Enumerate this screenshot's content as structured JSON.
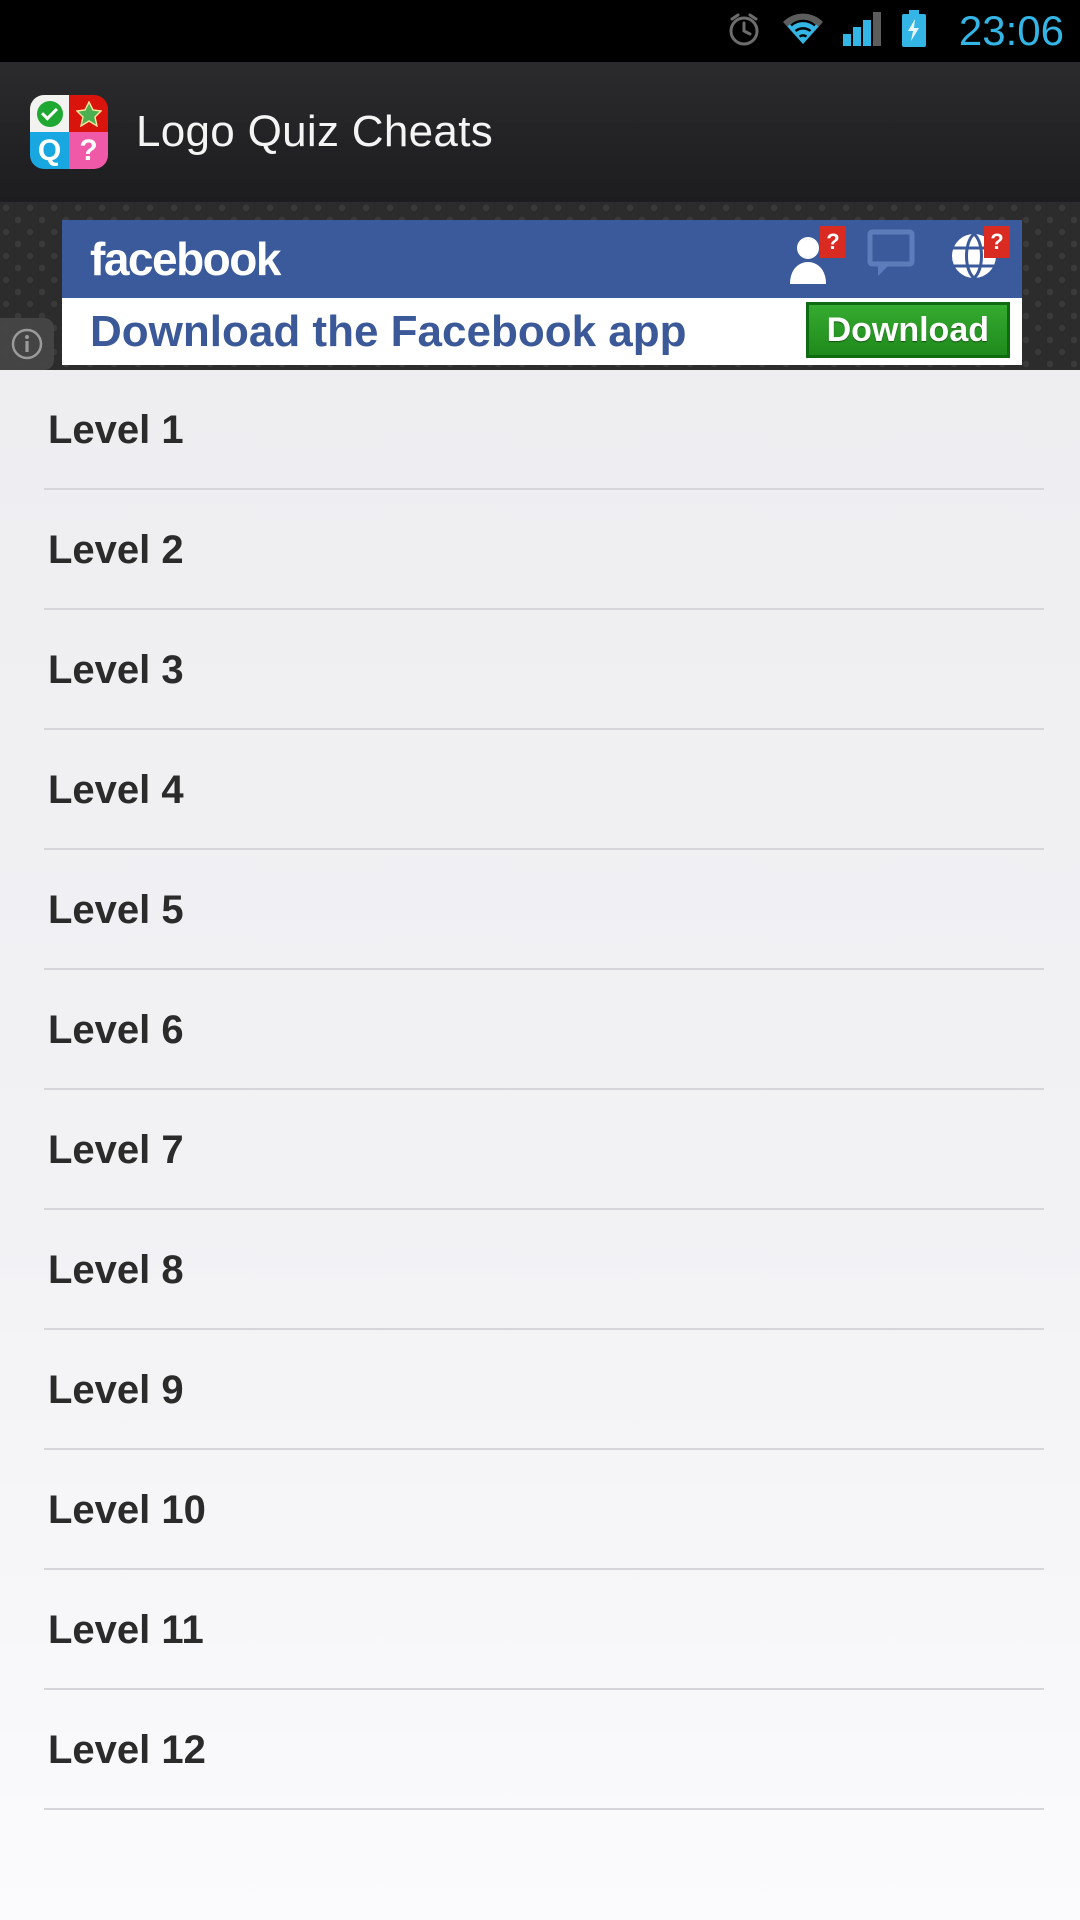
{
  "status_bar": {
    "time": "23:06",
    "icons": [
      {
        "name": "alarm-clock-icon",
        "label": "alarm"
      },
      {
        "name": "wifi-icon",
        "label": "wifi"
      },
      {
        "name": "cellular-signal-icon",
        "label": "signal"
      },
      {
        "name": "battery-charging-icon",
        "label": "battery charging"
      }
    ],
    "colors": {
      "background": "#000000",
      "accent": "#33B5E5"
    }
  },
  "action_bar": {
    "title": "Logo Quiz Cheats",
    "app_icon": {
      "name": "logo-quiz-cheats-app-icon",
      "tiles": [
        {
          "name": "check-icon",
          "glyph": "",
          "background": "#f2f2f0",
          "mark": "#1fa832"
        },
        {
          "name": "star-icon",
          "glyph": "",
          "background": "#d8140d",
          "mark": "#4caf50"
        },
        {
          "name": "letter-q-tile",
          "glyph": "Q",
          "background": "#18a7e0",
          "mark": "#ffffff"
        },
        {
          "name": "question-mark-tile",
          "glyph": "?",
          "background": "#ef59a8",
          "mark": "#ffffff"
        }
      ]
    },
    "colors": {
      "background": "#232325",
      "text": "#f4f4f4"
    }
  },
  "ad": {
    "network_info_label": "i",
    "brand": "facebook",
    "headline": "Download the Facebook app",
    "cta_label": "Download",
    "nav_badges": [
      "?",
      "?"
    ],
    "nav_icons": [
      {
        "name": "friend-requests-icon",
        "badge": "?"
      },
      {
        "name": "messages-icon",
        "badge": ""
      },
      {
        "name": "notifications-globe-icon",
        "badge": "?"
      }
    ],
    "colors": {
      "brand_blue": "#3a5a9b",
      "cta_green": "#2a9a2a",
      "text_blue": "#3b5998"
    }
  },
  "list": {
    "items": [
      {
        "label": "Level 1"
      },
      {
        "label": "Level 2"
      },
      {
        "label": "Level 3"
      },
      {
        "label": "Level 4"
      },
      {
        "label": "Level 5"
      },
      {
        "label": "Level 6"
      },
      {
        "label": "Level 7"
      },
      {
        "label": "Level 8"
      },
      {
        "label": "Level 9"
      },
      {
        "label": "Level 10"
      },
      {
        "label": "Level 11"
      },
      {
        "label": "Level 12"
      }
    ],
    "colors": {
      "background": "#eeeef1",
      "text": "#2b2b2b",
      "divider": "#d6d6da"
    }
  }
}
